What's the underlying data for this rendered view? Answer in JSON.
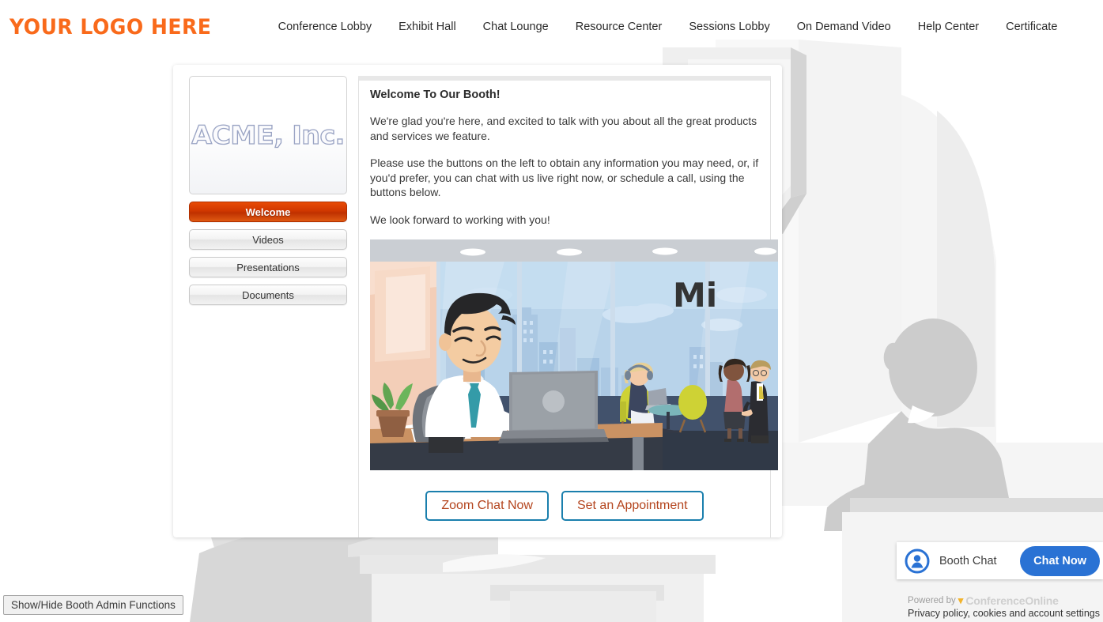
{
  "header": {
    "logo_text": "YOUR LOGO HERE",
    "logo_color": "#f96a1b",
    "nav": [
      {
        "label": "Conference Lobby"
      },
      {
        "label": "Exhibit Hall"
      },
      {
        "label": "Chat Lounge"
      },
      {
        "label": "Resource Center"
      },
      {
        "label": "Sessions Lobby"
      },
      {
        "label": "On Demand Video"
      },
      {
        "label": "Help Center"
      },
      {
        "label": "Certificate"
      }
    ]
  },
  "booth": {
    "company_logo_text": "ACME, Inc.",
    "tabs": [
      {
        "label": "Welcome",
        "active": true
      },
      {
        "label": "Videos",
        "active": false
      },
      {
        "label": "Presentations",
        "active": false
      },
      {
        "label": "Documents",
        "active": false
      }
    ],
    "active_tab_color": "#d03700"
  },
  "content": {
    "heading": "Welcome To Our Booth!",
    "paragraph_1": "We're glad you're here, and excited to talk with you about all the great products and services we feature.",
    "paragraph_2": "Please use the buttons on the left to obtain any information you may need, or, if you'd prefer, you can chat with us live right now, or schedule a call, using the buttons below.",
    "paragraph_3": "We look forward to working with you!",
    "video_sign_text": "Mi",
    "cta_buttons": [
      {
        "label": "Zoom Chat Now"
      },
      {
        "label": "Set an Appointment"
      }
    ],
    "cta_border_color": "#1a7fad",
    "cta_text_color": "#b4451e"
  },
  "admin": {
    "button_label": "Show/Hide Booth Admin Functions"
  },
  "chat_widget": {
    "title": "Booth Chat",
    "button_label": "Chat Now",
    "button_color": "#2a72d4",
    "avatar_icon": "person-avatar-icon"
  },
  "footer": {
    "powered_by": "Powered by",
    "brand": "ConferenceOnline",
    "brand_mark": "▾",
    "privacy": "Privacy policy, cookies and account settings"
  }
}
